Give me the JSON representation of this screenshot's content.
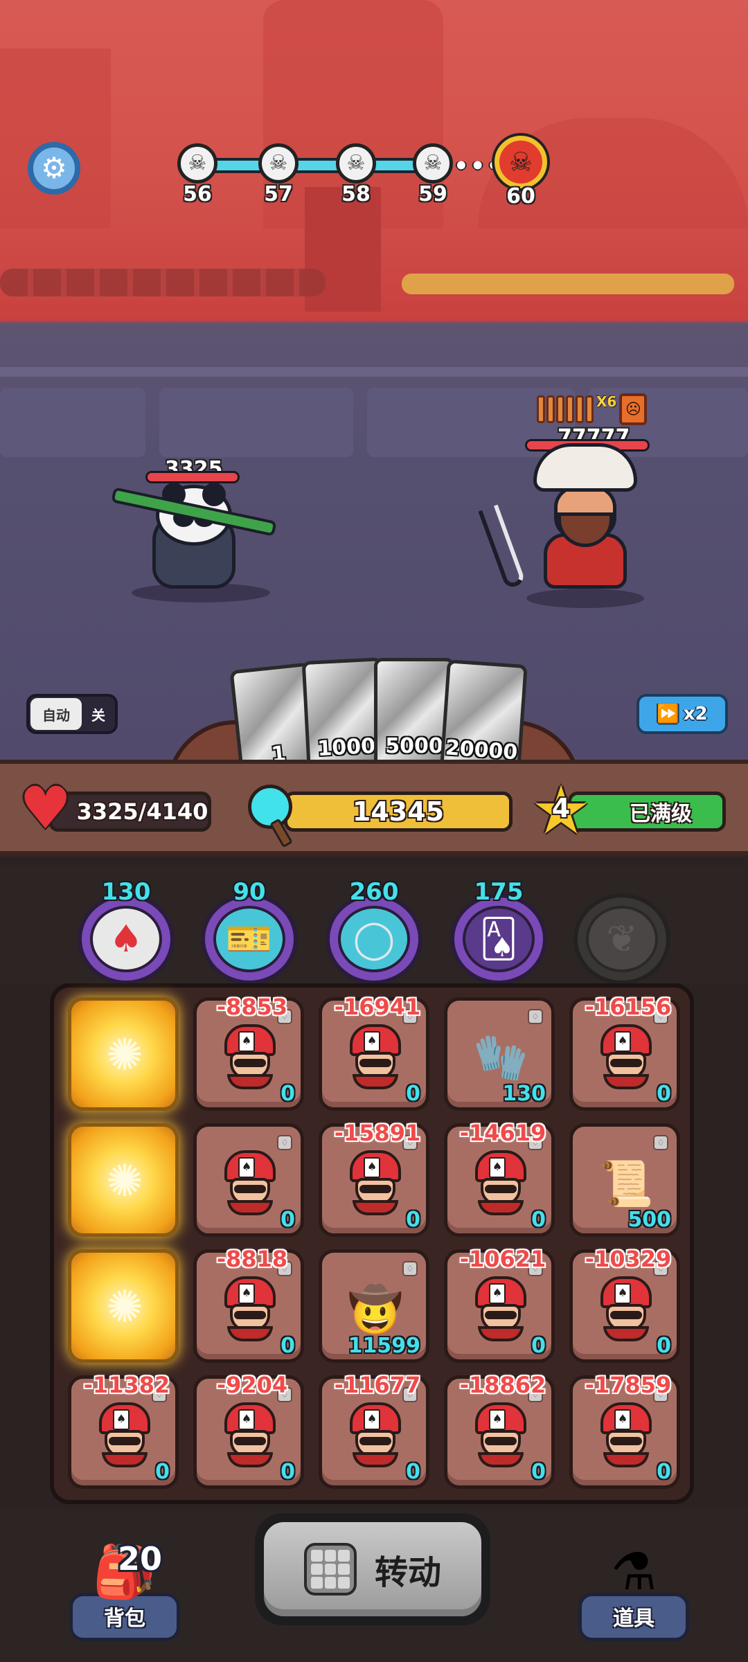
{
  "top": {
    "settings_icon": "gear-icon",
    "stages": [
      {
        "number": "56",
        "icon": "skull-icon"
      },
      {
        "number": "57",
        "icon": "skull-icon"
      },
      {
        "number": "58",
        "icon": "skull-icon"
      },
      {
        "number": "59",
        "icon": "skull-icon"
      }
    ],
    "ellipsis": "•••",
    "boss_stage": {
      "number": "60",
      "icon": "demon-skull-icon"
    }
  },
  "battle": {
    "player": {
      "hp_text": "3325",
      "hp_fraction": 1.0
    },
    "boss": {
      "hp_text": "77777",
      "hp_fraction": 1.0,
      "buff_multiplier": "X6",
      "buff_stack_count": 6
    },
    "cards": [
      "1",
      "1000",
      "5000",
      "20000"
    ],
    "auto": {
      "label": "自动",
      "state": "关"
    },
    "speed": {
      "label": "x2",
      "icon": "fast-forward-icon"
    }
  },
  "status": {
    "hp": "3325/4140",
    "gold": "14345",
    "level": "4",
    "level_status": "已满级"
  },
  "relics": [
    {
      "count": "130",
      "icon": "poker-chip-icon",
      "glyph": "♠",
      "locked": false
    },
    {
      "count": "90",
      "icon": "ticket-icon",
      "glyph": "🎫",
      "locked": false
    },
    {
      "count": "260",
      "icon": "ring-icon",
      "glyph": "◯",
      "locked": false
    },
    {
      "count": "175",
      "icon": "playing-cards-icon",
      "glyph": "🂡",
      "locked": false
    },
    {
      "count": "",
      "icon": "locked-relic-icon",
      "glyph": "❦",
      "locked": true
    }
  ],
  "board": [
    [
      {
        "kind": "glow",
        "damage": "",
        "value": ""
      },
      {
        "kind": "enemy",
        "damage": "-8853",
        "value": "0"
      },
      {
        "kind": "enemy",
        "damage": "-16941",
        "value": "0"
      },
      {
        "kind": "item",
        "icon": "glove-icon",
        "glyph": "🧤",
        "damage": "",
        "value": "130"
      },
      {
        "kind": "enemy",
        "damage": "-16156",
        "value": "0"
      }
    ],
    [
      {
        "kind": "glow",
        "damage": "",
        "value": ""
      },
      {
        "kind": "enemy",
        "damage": "",
        "value": "0"
      },
      {
        "kind": "enemy",
        "damage": "-15891",
        "value": "0"
      },
      {
        "kind": "enemy",
        "damage": "-14619",
        "value": "0"
      },
      {
        "kind": "item",
        "icon": "scroll-potion-icon",
        "glyph": "📜",
        "damage": "",
        "value": "500"
      }
    ],
    [
      {
        "kind": "glow",
        "damage": "",
        "value": ""
      },
      {
        "kind": "enemy",
        "damage": "-8818",
        "value": "0"
      },
      {
        "kind": "item",
        "icon": "gunslinger-icon",
        "glyph": "🤠",
        "damage": "",
        "value": "11599"
      },
      {
        "kind": "enemy",
        "damage": "-10621",
        "value": "0"
      },
      {
        "kind": "enemy",
        "damage": "-10329",
        "value": "0"
      }
    ],
    [
      {
        "kind": "enemy",
        "damage": "-11382",
        "value": "0"
      },
      {
        "kind": "enemy",
        "damage": "-9204",
        "value": "0"
      },
      {
        "kind": "enemy",
        "damage": "-11677",
        "value": "0"
      },
      {
        "kind": "enemy",
        "damage": "-18862",
        "value": "0"
      },
      {
        "kind": "enemy",
        "damage": "-17859",
        "value": "0"
      }
    ]
  ],
  "bottom": {
    "bag": {
      "label": "背包",
      "count": "20",
      "icon": "backpack-icon"
    },
    "spin": {
      "label": "转动",
      "icon": "slot-grid-icon"
    },
    "items": {
      "label": "道具",
      "icon": "potion-icon"
    }
  }
}
